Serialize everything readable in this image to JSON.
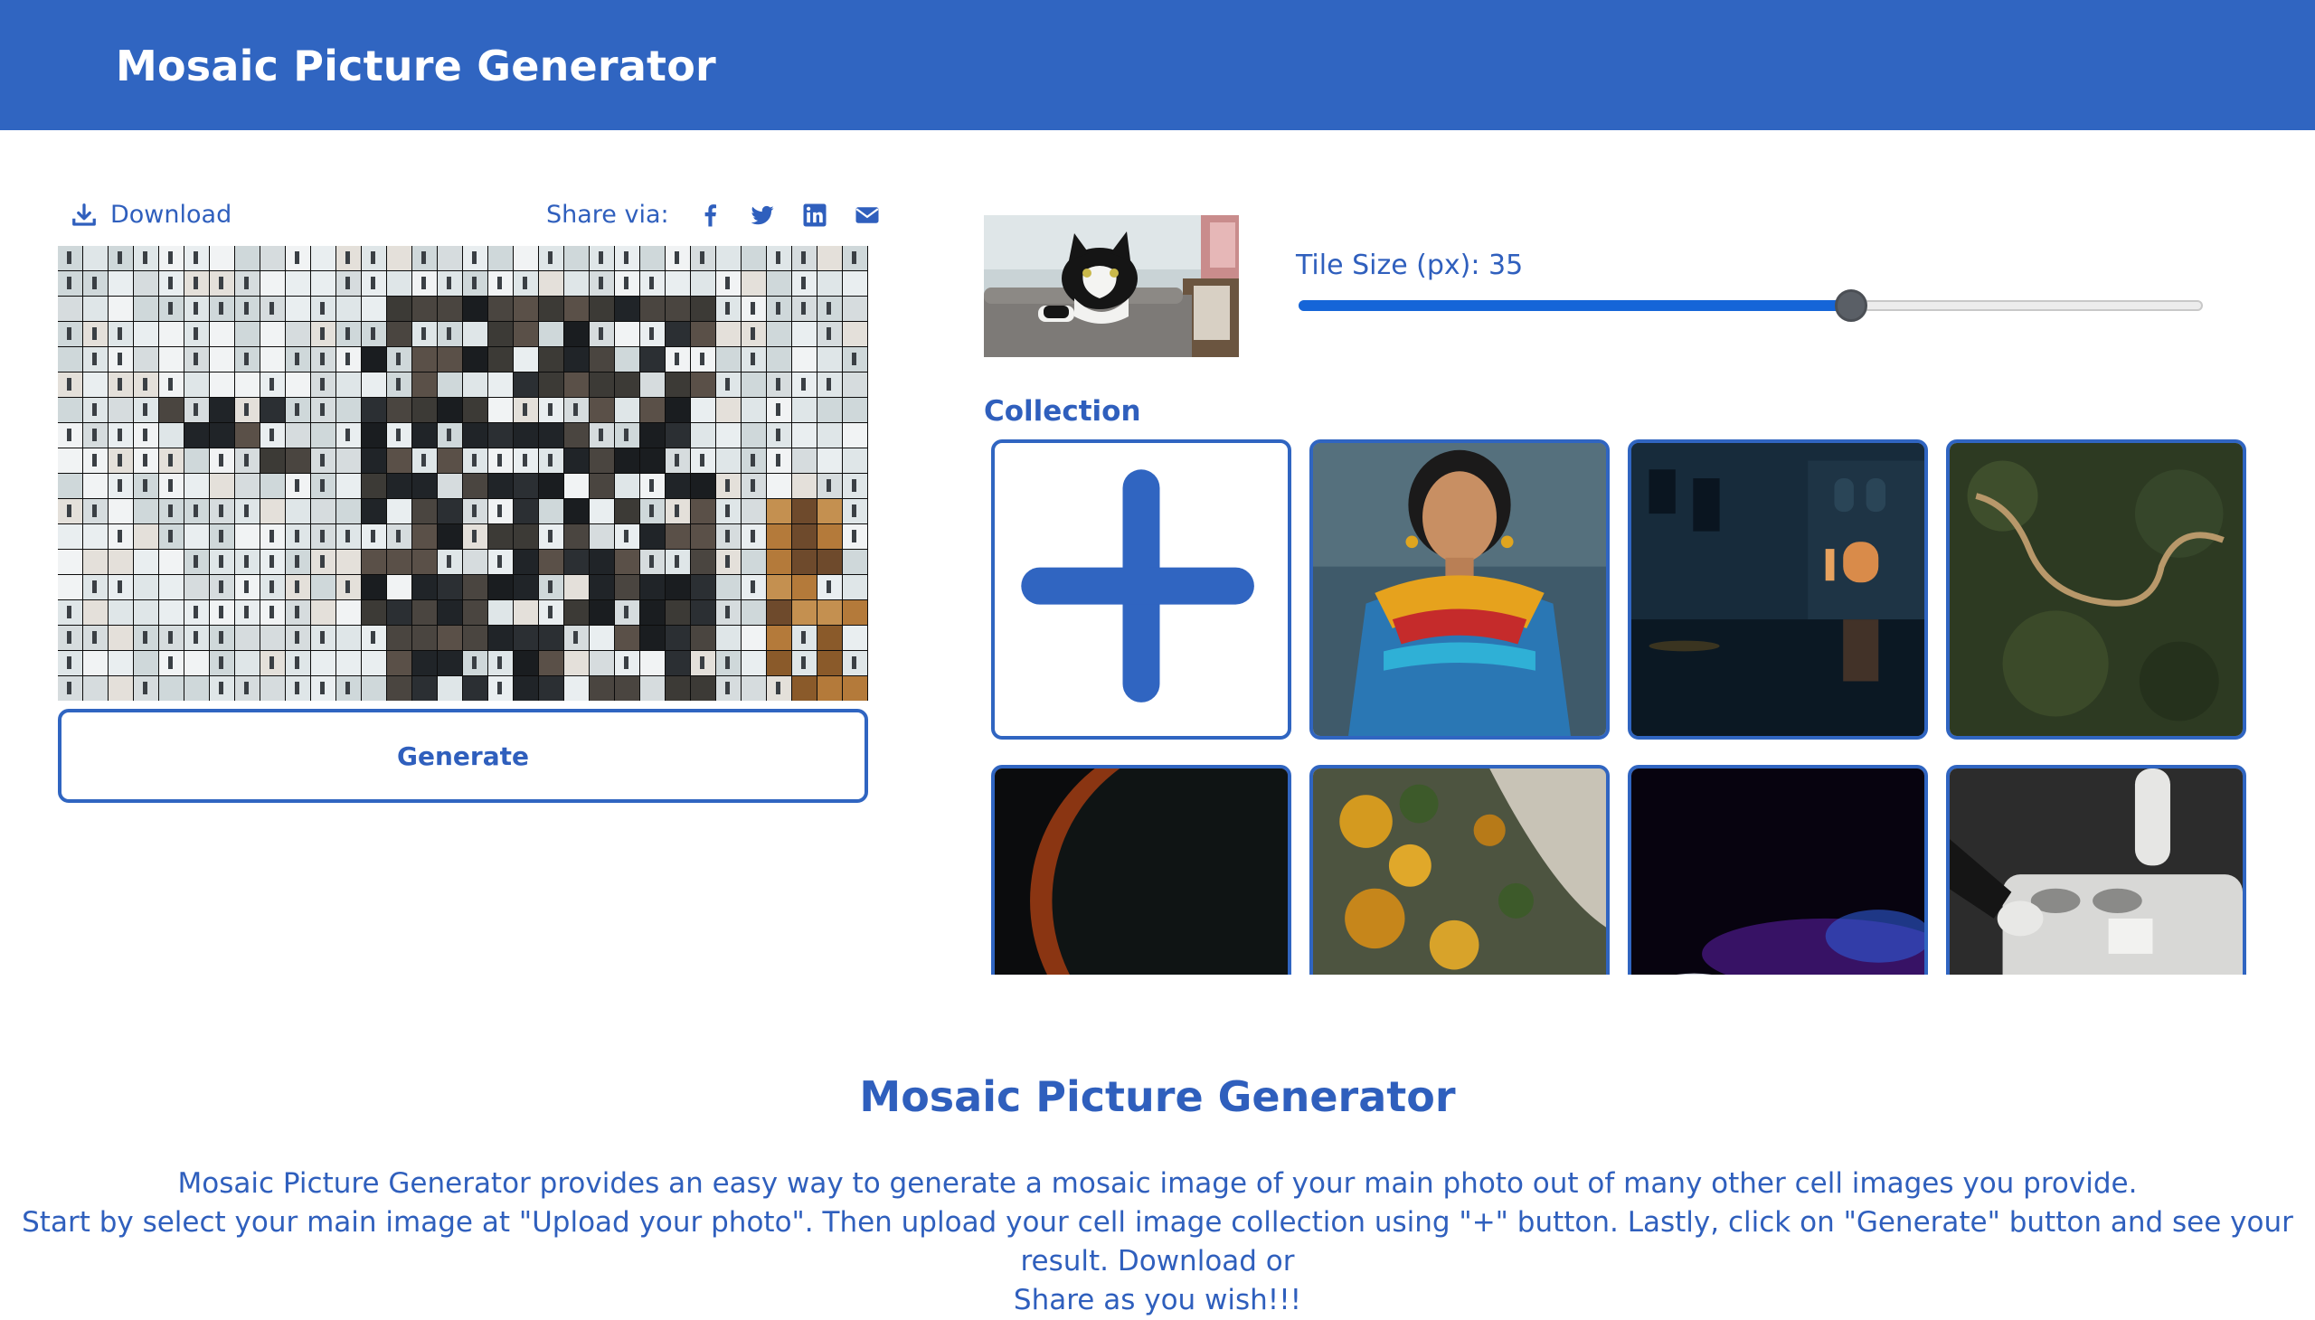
{
  "header": {
    "title": "Mosaic Picture Generator"
  },
  "toolbar": {
    "download_label": "Download",
    "share_label": "Share via:",
    "share_icons": [
      "facebook-icon",
      "twitter-icon",
      "linkedin-icon",
      "email-icon"
    ]
  },
  "generate": {
    "label": "Generate"
  },
  "tile": {
    "label": "Tile Size (px): 35",
    "value": 35,
    "min": 5,
    "max": 50
  },
  "collection": {
    "title": "Collection",
    "add_icon": "plus-icon",
    "items": [
      "woman-portrait",
      "canal-night",
      "forest-aerial",
      "planet-eclipse",
      "autumn-forest",
      "purple-waves",
      "hands-machine"
    ]
  },
  "info": {
    "title": "Mosaic Picture Generator",
    "line1": "Mosaic Picture Generator provides an easy way to generate a mosaic image of your main photo out of many other cell images you provide.",
    "line2": "Start by select your main image at \"Upload your photo\". Then upload your cell image collection using \"+\" button. Lastly, click on \"Generate\" button and see your result. Download or",
    "line3": "Share as you wish!!!"
  },
  "colors": {
    "brand": "#3065c1",
    "text": "#2f5fbd",
    "slider_fill": "#1565d8"
  }
}
